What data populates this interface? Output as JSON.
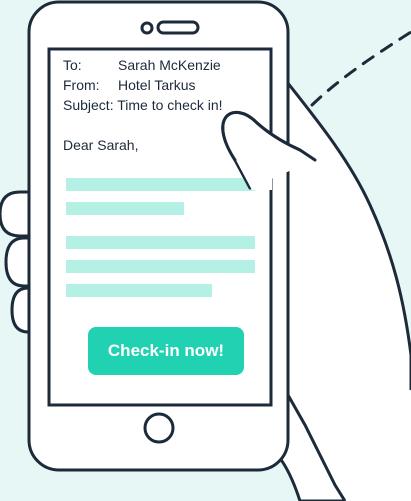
{
  "email": {
    "to_label": "To:",
    "to_value": "Sarah McKenzie",
    "from_label": "From:",
    "from_value": "Hotel Tarkus",
    "subject_label": "Subject:",
    "subject_value": "Time to check in!",
    "greeting": "Dear Sarah,"
  },
  "cta": {
    "label": "Check-in now!"
  },
  "colors": {
    "background": "#e6f7f5",
    "accent": "#20d1b2",
    "text_line_placeholder": "#b5f0e5",
    "outline": "#1d2a3a",
    "white": "#ffffff"
  },
  "icons": [
    "speaker-slot-icon",
    "home-button-icon",
    "hand-illustration",
    "dashed-arc-decoration"
  ]
}
